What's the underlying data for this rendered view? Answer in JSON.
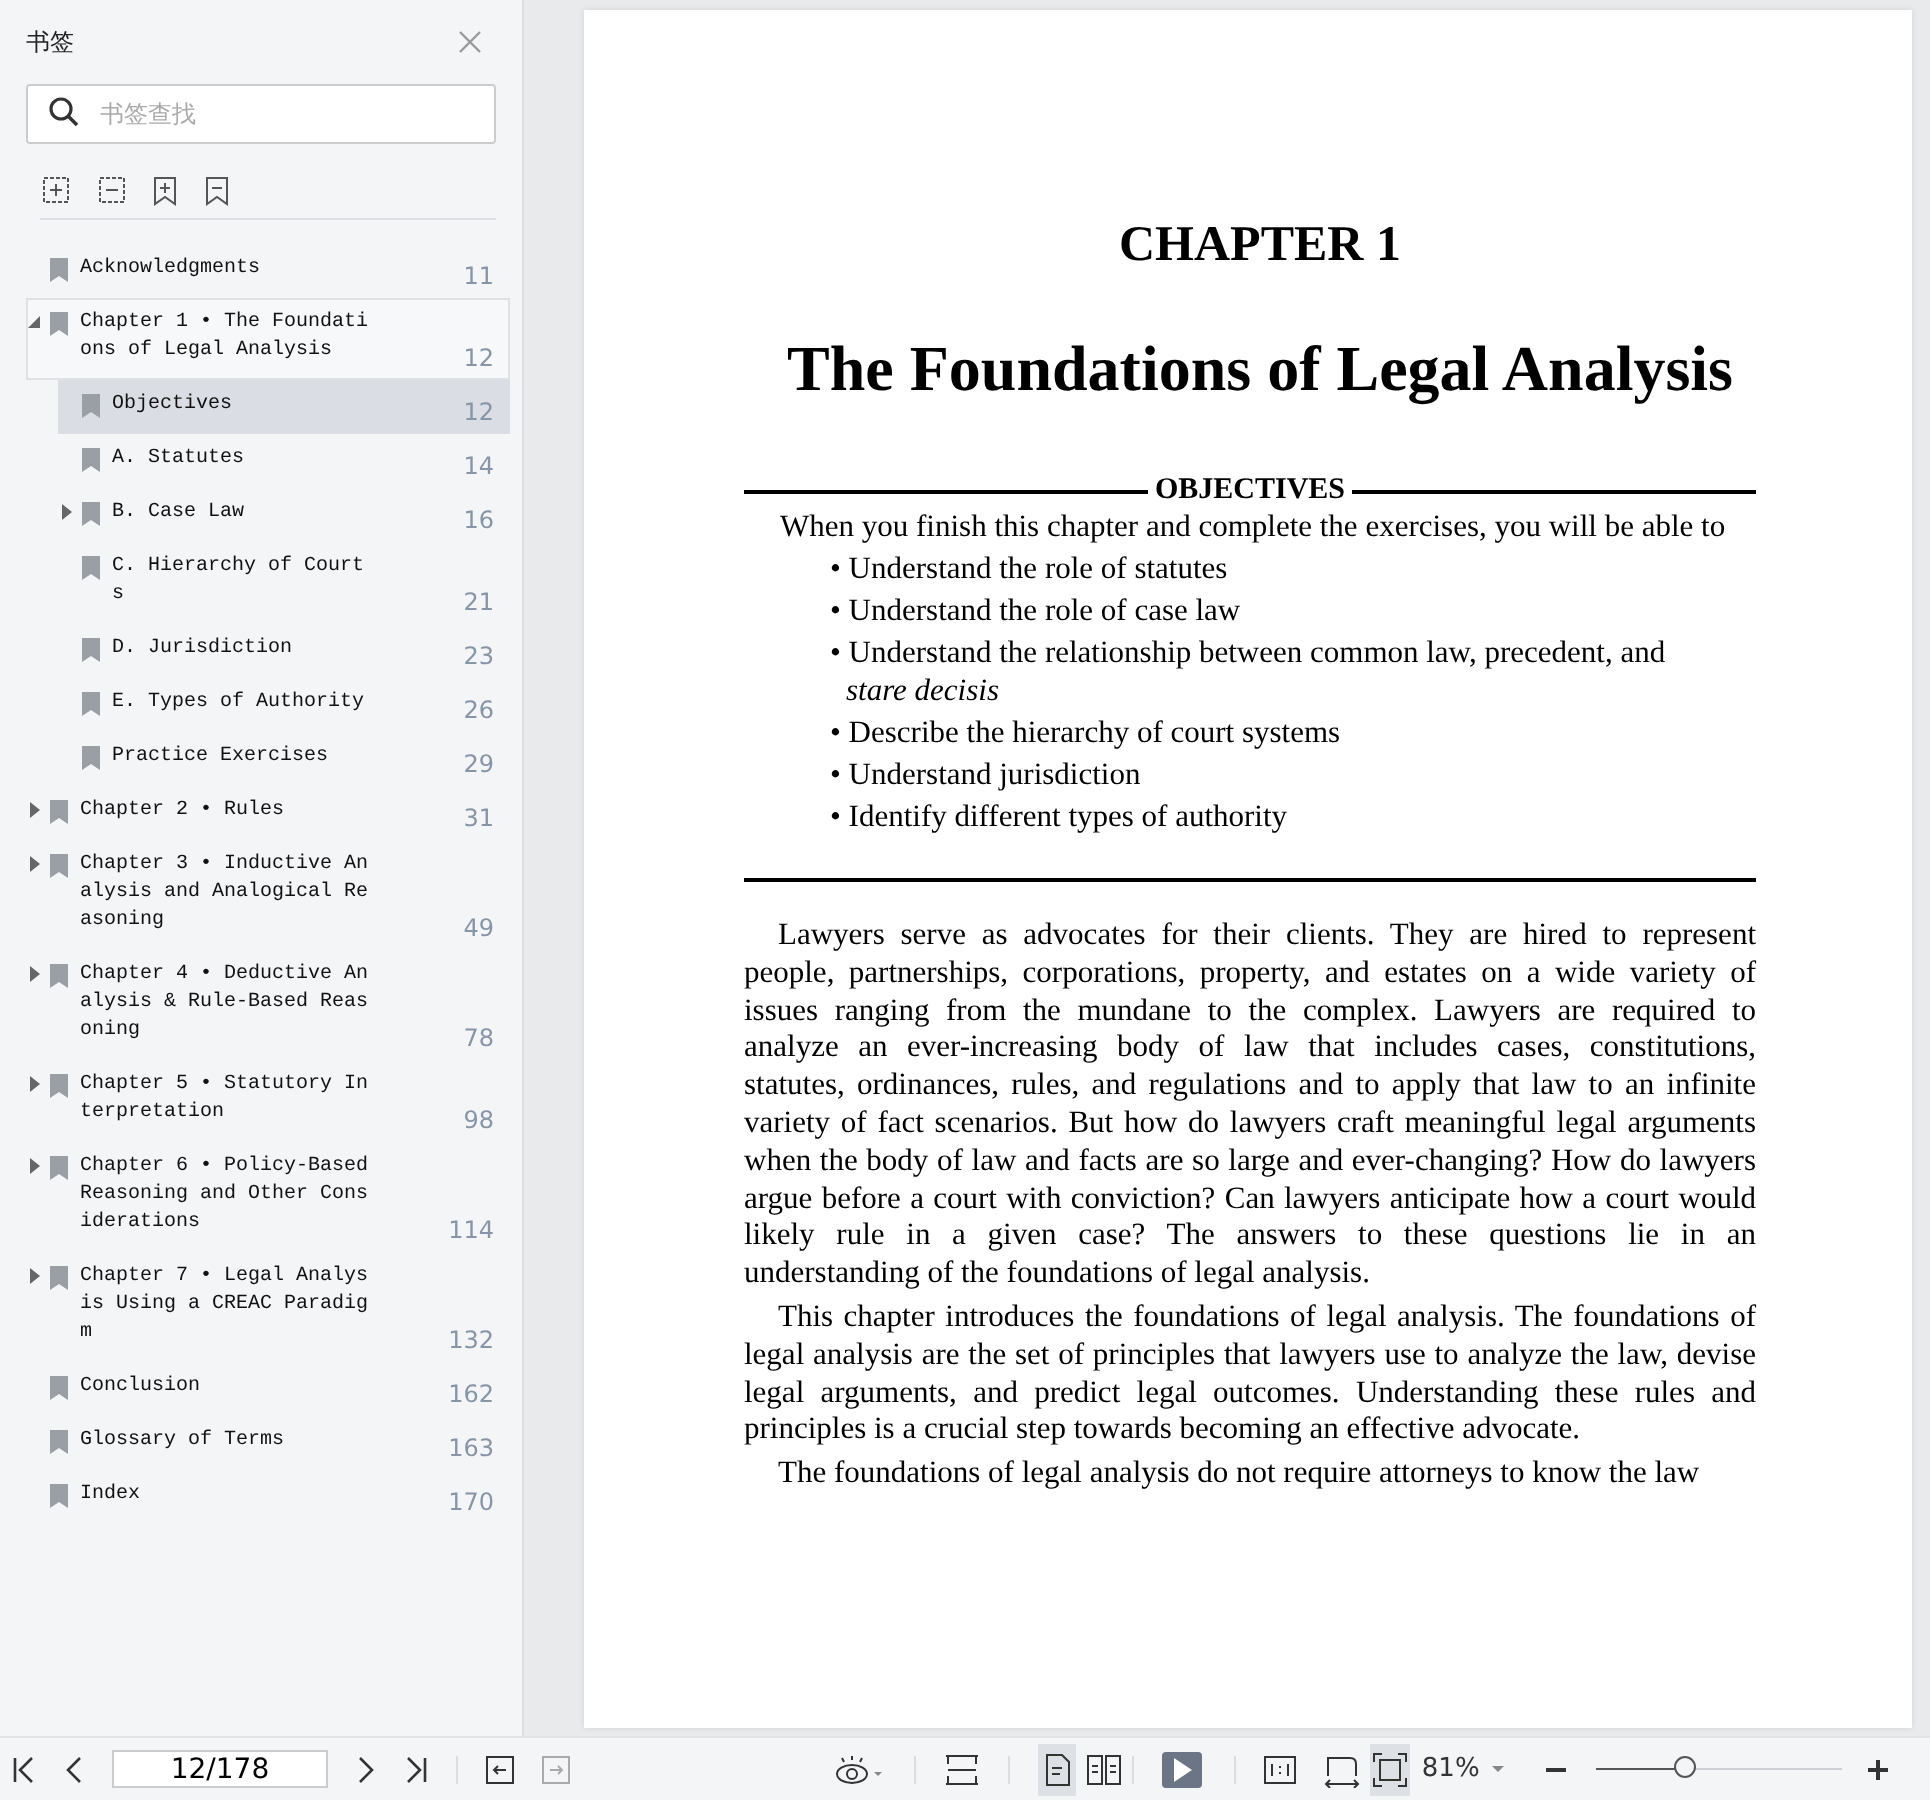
{
  "sidebar": {
    "title": "书签",
    "search": {
      "placeholder": "书签查找"
    },
    "bookmarks": [
      {
        "kind": "leaf",
        "label": "Acknowledgments",
        "page": "11",
        "selected": false,
        "hovered": false
      },
      {
        "kind": "branch",
        "label": "Chapter 1 • The Foundations of Legal Analysis",
        "page": "12",
        "selected": false,
        "hovered": true,
        "expanded": true,
        "children": [
          {
            "kind": "leaf",
            "label": "Objectives",
            "page": "12",
            "selected": true,
            "hovered": false
          },
          {
            "kind": "leaf",
            "label": "A. Statutes",
            "page": "14",
            "selected": false,
            "hovered": false
          },
          {
            "kind": "branch",
            "label": "B. Case Law",
            "page": "16",
            "selected": false,
            "hovered": false,
            "expanded": false
          },
          {
            "kind": "leaf",
            "label": "C. Hierarchy of Courts",
            "page": "21",
            "selected": false,
            "hovered": false
          },
          {
            "kind": "leaf",
            "label": "D. Jurisdiction",
            "page": "23",
            "selected": false,
            "hovered": false
          },
          {
            "kind": "leaf",
            "label": "E. Types of Authority",
            "page": "26",
            "selected": false,
            "hovered": false
          },
          {
            "kind": "leaf",
            "label": "Practice Exercises",
            "page": "29",
            "selected": false,
            "hovered": false
          }
        ]
      },
      {
        "kind": "branch",
        "label": "Chapter 2 • Rules",
        "page": "31",
        "selected": false,
        "hovered": false,
        "expanded": false
      },
      {
        "kind": "branch",
        "label": "Chapter 3 • Inductive Analysis and Analogical Reasoning",
        "page": "49",
        "selected": false,
        "hovered": false,
        "expanded": false
      },
      {
        "kind": "branch",
        "label": "Chapter 4 • Deductive Analysis & Rule-Based Reasoning",
        "page": "78",
        "selected": false,
        "hovered": false,
        "expanded": false
      },
      {
        "kind": "branch",
        "label": "Chapter 5 • Statutory Interpretation",
        "page": "98",
        "selected": false,
        "hovered": false,
        "expanded": false
      },
      {
        "kind": "branch",
        "label": "Chapter 6 • Policy-Based Reasoning and Other Considerations",
        "page": "114",
        "selected": false,
        "hovered": false,
        "expanded": false
      },
      {
        "kind": "branch",
        "label": "Chapter 7 • Legal Analysis Using a CREAC Paradigm",
        "page": "132",
        "selected": false,
        "hovered": false,
        "expanded": false
      },
      {
        "kind": "leaf",
        "label": "Conclusion",
        "page": "162",
        "selected": false,
        "hovered": false
      },
      {
        "kind": "leaf",
        "label": "Glossary of Terms",
        "page": "163",
        "selected": false,
        "hovered": false
      },
      {
        "kind": "leaf",
        "label": "Index",
        "page": "170",
        "selected": false,
        "hovered": false
      }
    ]
  },
  "document": {
    "chapter": "CHAPTER 1",
    "title": "The Foundations of Legal Analysis",
    "objectives_heading": "OBJECTIVES",
    "objectives_intro": "When you finish this chapter and complete the exercises, you will be able to",
    "objectives": [
      "• Understand the role of statutes",
      "• Understand the role of case law",
      "• Understand the relationship between common law, precedent, and *stare decisis*",
      "• Describe the hierarchy of court systems",
      "• Understand jurisdiction",
      "• Identify different types of authority"
    ],
    "paragraphs": [
      "Lawyers serve as advocates for their clients. They are hired to represent people, partnerships, corporations, property, and estates on a wide variety of issues ranging from the mundane to the complex. Lawyers are required to analyze an ever-increasing body of law that includes cases, constitutions, statutes, ordinances, rules, and regulations and to apply that law to an infinite variety of fact scenarios. But how do lawyers craft meaningful legal arguments when the body of law and facts are so large and ever-changing? How do lawyers argue before a court with conviction? Can lawyers anticipate how a court would likely rule in a given case? The answers to these questions lie in an understanding of the foundations of legal analysis.",
      "This chapter introduces the foundations of legal analysis. The foundations of legal analysis are the set of principles that lawyers use to analyze the law, devise legal arguments, and predict legal outcomes. Understanding these rules and principles is a crucial step towards becoming an effective advocate.",
      "The foundations of legal analysis do not require attorneys to know the law"
    ]
  },
  "toolbar": {
    "page_field": "12/178",
    "back_enabled": true,
    "forward_enabled": false,
    "view_modes": [
      {
        "selected": true
      },
      {
        "selected": false
      }
    ],
    "fit_modes": [
      {
        "selected": false
      },
      {
        "selected": true
      }
    ],
    "zoom": "81%",
    "zoom_slider": {
      "level": 0.37
    }
  }
}
